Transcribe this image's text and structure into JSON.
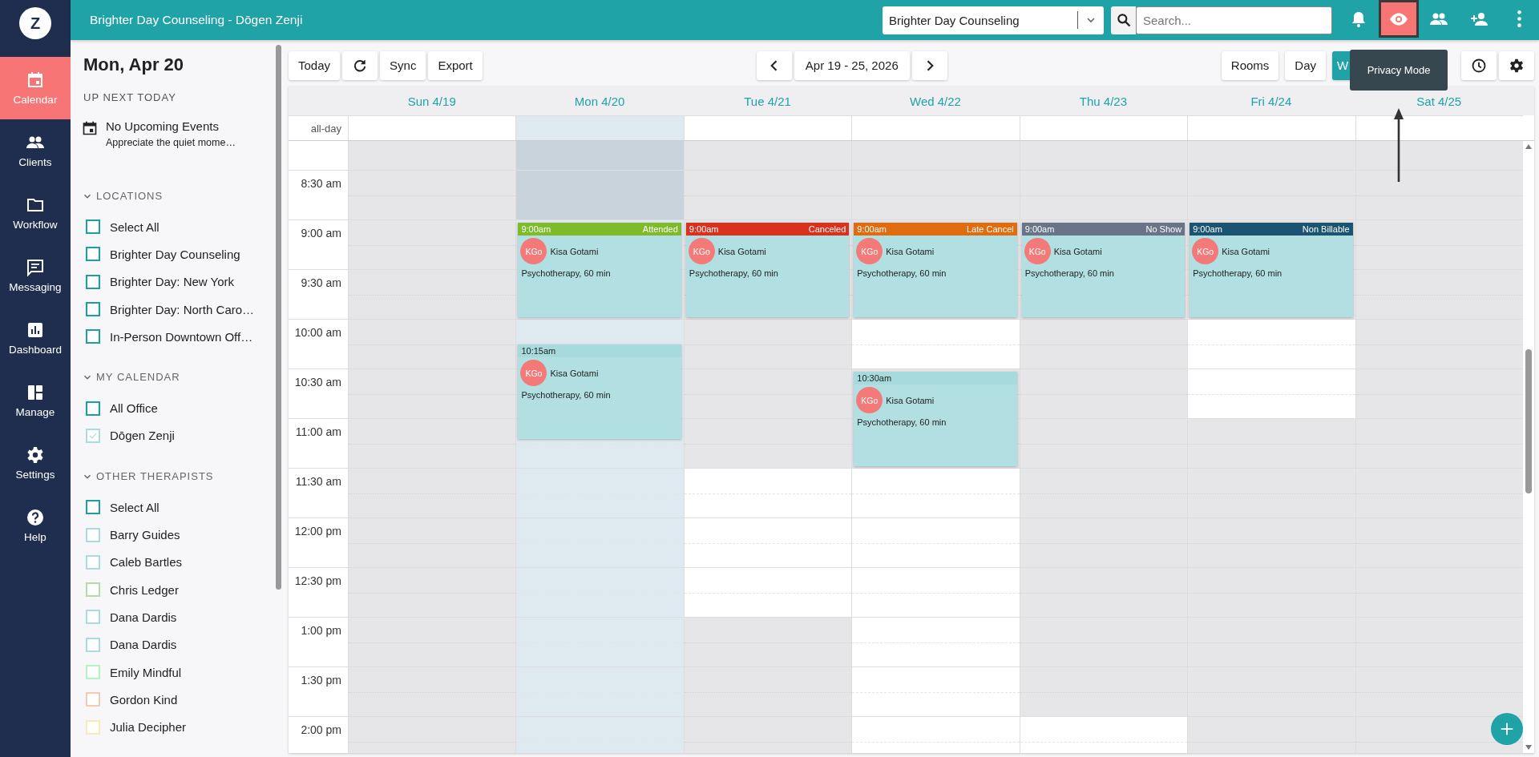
{
  "nav": {
    "logo": "Z",
    "items": [
      {
        "label": "Calendar",
        "selected": true
      },
      {
        "label": "Clients",
        "selected": false
      },
      {
        "label": "Workflow",
        "selected": false
      },
      {
        "label": "Messaging",
        "selected": false
      },
      {
        "label": "Dashboard",
        "selected": false
      },
      {
        "label": "Manage",
        "selected": false
      },
      {
        "label": "Settings",
        "selected": false
      },
      {
        "label": "Help",
        "selected": false
      }
    ]
  },
  "header": {
    "title": "Brighter Day Counseling - Dōgen Zenji",
    "location_select": "Brighter Day Counseling",
    "search": {
      "placeholder": "Search..."
    },
    "actions": [
      {
        "selected": false
      },
      {
        "selected": true,
        "tooltip": "Privacy Mode"
      },
      {
        "selected": false
      },
      {
        "selected": false
      },
      {
        "selected": false
      }
    ]
  },
  "side_panel": {
    "date": "Mon, Apr 20",
    "up_next": {
      "heading": "UP NEXT TODAY",
      "title": "No Upcoming Events",
      "subtitle": "Appreciate the quiet mome…"
    },
    "sections": [
      {
        "heading": "LOCATIONS",
        "expanded": true,
        "items": [
          {
            "label": "Select All",
            "checked": false,
            "color": "#1a9fa5"
          },
          {
            "label": "Brighter Day Counseling",
            "checked": false,
            "color": "#1a9fa5"
          },
          {
            "label": "Brighter Day: New York",
            "checked": false,
            "color": "#1a9fa5"
          },
          {
            "label": "Brighter Day: North Caro…",
            "checked": false,
            "color": "#1a9fa5"
          },
          {
            "label": "In-Person Downtown Off…",
            "checked": false,
            "color": "#1a9fa5"
          }
        ]
      },
      {
        "heading": "MY CALENDAR",
        "expanded": true,
        "items": [
          {
            "label": "All Office",
            "checked": false,
            "color": "#1a9fa5"
          },
          {
            "label": "Dōgen Zenji",
            "checked": true,
            "color": "#a8dde0"
          }
        ]
      },
      {
        "heading": "OTHER THERAPISTS",
        "expanded": true,
        "items": [
          {
            "label": "Select All",
            "checked": false,
            "color": "#1a9fa5"
          },
          {
            "label": "Barry Guides",
            "checked": false,
            "color": "#a8dde0"
          },
          {
            "label": "Caleb Bartles",
            "checked": false,
            "color": "#a8dde0"
          },
          {
            "label": "Chris Ledger",
            "checked": false,
            "color": "#b9d8a8"
          },
          {
            "label": "Dana Dardis",
            "checked": false,
            "color": "#a8dde0"
          },
          {
            "label": "Dana Dardis",
            "checked": false,
            "color": "#a8dde0"
          },
          {
            "label": "Emily Mindful",
            "checked": false,
            "color": "#b4f2c4"
          },
          {
            "label": "Gordon Kind",
            "checked": false,
            "color": "#f6c9b2"
          },
          {
            "label": "Julia Decipher",
            "checked": false,
            "color": "#f8ecb4"
          }
        ]
      }
    ]
  },
  "toolbar": {
    "left": [
      {
        "kind": "text",
        "label": "Today"
      },
      {
        "kind": "icon"
      },
      {
        "kind": "text",
        "label": "Sync"
      },
      {
        "kind": "text",
        "label": "Export"
      }
    ],
    "range": "Apr 19 - 25, 2026",
    "views": [
      {
        "label": "Rooms",
        "selected": false
      },
      {
        "label": "Day",
        "selected": false
      },
      {
        "label": "W",
        "selected": true
      }
    ]
  },
  "calendar": {
    "all_day_label": "all-day",
    "times": [
      "8:30 am",
      "9:00 am",
      "9:30 am",
      "10:00 am",
      "10:30 am",
      "11:00 am",
      "11:30 am",
      "12:00 pm",
      "12:30 pm",
      "1:00 pm",
      "1:30 pm",
      "2:00 pm"
    ],
    "days": [
      {
        "label": "Sun 4/19",
        "today": false,
        "slots": [
          {
            "open": false
          },
          {
            "open": false
          },
          {
            "open": false
          },
          {
            "open": false
          },
          {
            "open": false
          },
          {
            "open": false
          },
          {
            "open": false
          },
          {
            "open": false
          },
          {
            "open": false
          },
          {
            "open": false
          },
          {
            "open": false
          },
          {
            "open": false
          },
          {
            "open": false
          }
        ]
      },
      {
        "label": "Mon 4/20",
        "today": true,
        "slots": [
          {
            "open": false
          },
          {
            "open": false
          },
          {
            "open": true,
            "events": [
              {
                "kind": "aligned",
                "time": "9:00am",
                "status": "Attended",
                "color": "#7dbb2b",
                "avatar": "KGo",
                "client": "Kisa Gotami",
                "service": "Psychotherapy, 60 min"
              }
            ]
          },
          {
            "open": true
          },
          {
            "open": true,
            "events": [
              {
                "kind": "offset",
                "time": "10:15am",
                "color": "#a6dadd",
                "avatar": "KGo",
                "client": "Kisa Gotami",
                "service": "Psychotherapy, 60 min"
              }
            ]
          },
          {
            "open": true
          },
          {
            "open": true
          },
          {
            "open": true
          },
          {
            "open": true
          },
          {
            "open": true
          },
          {
            "open": true
          },
          {
            "open": true
          },
          {
            "open": true
          }
        ]
      },
      {
        "label": "Tue 4/21",
        "today": false,
        "slots": [
          {
            "open": false
          },
          {
            "open": false
          },
          {
            "open": false,
            "events": [
              {
                "kind": "aligned",
                "time": "9:00am",
                "status": "Canceled",
                "color": "#d8321e",
                "avatar": "KGo",
                "client": "Kisa Gotami",
                "service": "Psychotherapy, 60 min"
              }
            ]
          },
          {
            "open": false
          },
          {
            "open": false
          },
          {
            "open": false
          },
          {
            "open": false
          },
          {
            "open": true
          },
          {
            "open": true
          },
          {
            "open": true
          },
          {
            "open": false
          },
          {
            "open": false
          },
          {
            "open": false
          }
        ]
      },
      {
        "label": "Wed 4/22",
        "today": false,
        "slots": [
          {
            "open": false
          },
          {
            "open": false
          },
          {
            "open": false,
            "events": [
              {
                "kind": "aligned",
                "time": "9:00am",
                "status": "Late Cancel",
                "color": "#e06c10",
                "avatar": "KGo",
                "client": "Kisa Gotami",
                "service": "Psychotherapy, 60 min"
              }
            ]
          },
          {
            "open": false
          },
          {
            "open": true
          },
          {
            "open": false,
            "events": [
              {
                "kind": "aligned",
                "time": "10:30am",
                "color": "#a6dadd",
                "avatar": "KGo",
                "client": "Kisa Gotami",
                "service": "Psychotherapy, 60 min"
              }
            ]
          },
          {
            "open": false
          },
          {
            "open": true
          },
          {
            "open": true
          },
          {
            "open": true
          },
          {
            "open": true
          },
          {
            "open": true
          },
          {
            "open": true
          }
        ]
      },
      {
        "label": "Thu 4/23",
        "today": false,
        "slots": [
          {
            "open": false
          },
          {
            "open": false
          },
          {
            "open": false,
            "events": [
              {
                "kind": "aligned",
                "time": "9:00am",
                "status": "No Show",
                "color": "#687488",
                "avatar": "KGo",
                "client": "Kisa Gotami",
                "service": "Psychotherapy, 60 min"
              }
            ]
          },
          {
            "open": false
          },
          {
            "open": false
          },
          {
            "open": false
          },
          {
            "open": false
          },
          {
            "open": false
          },
          {
            "open": false
          },
          {
            "open": false
          },
          {
            "open": false
          },
          {
            "open": false
          },
          {
            "open": true
          }
        ]
      },
      {
        "label": "Fri 4/24",
        "today": false,
        "slots": [
          {
            "open": false
          },
          {
            "open": false
          },
          {
            "open": false,
            "events": [
              {
                "kind": "aligned",
                "time": "9:00am",
                "status": "Non Billable",
                "color": "#1b5470",
                "avatar": "KGo",
                "client": "Kisa Gotami",
                "service": "Psychotherapy, 60 min"
              }
            ]
          },
          {
            "open": false
          },
          {
            "open": true
          },
          {
            "open": true
          },
          {
            "open": false
          },
          {
            "open": false
          },
          {
            "open": false
          },
          {
            "open": false
          },
          {
            "open": false
          },
          {
            "open": false
          },
          {
            "open": false
          }
        ]
      },
      {
        "label": "Sat 4/25",
        "today": false,
        "slots": [
          {
            "open": false
          },
          {
            "open": false
          },
          {
            "open": false
          },
          {
            "open": false
          },
          {
            "open": false
          },
          {
            "open": false
          },
          {
            "open": false
          },
          {
            "open": false
          },
          {
            "open": false
          },
          {
            "open": false
          },
          {
            "open": false
          },
          {
            "open": false
          },
          {
            "open": false
          }
        ]
      }
    ]
  }
}
